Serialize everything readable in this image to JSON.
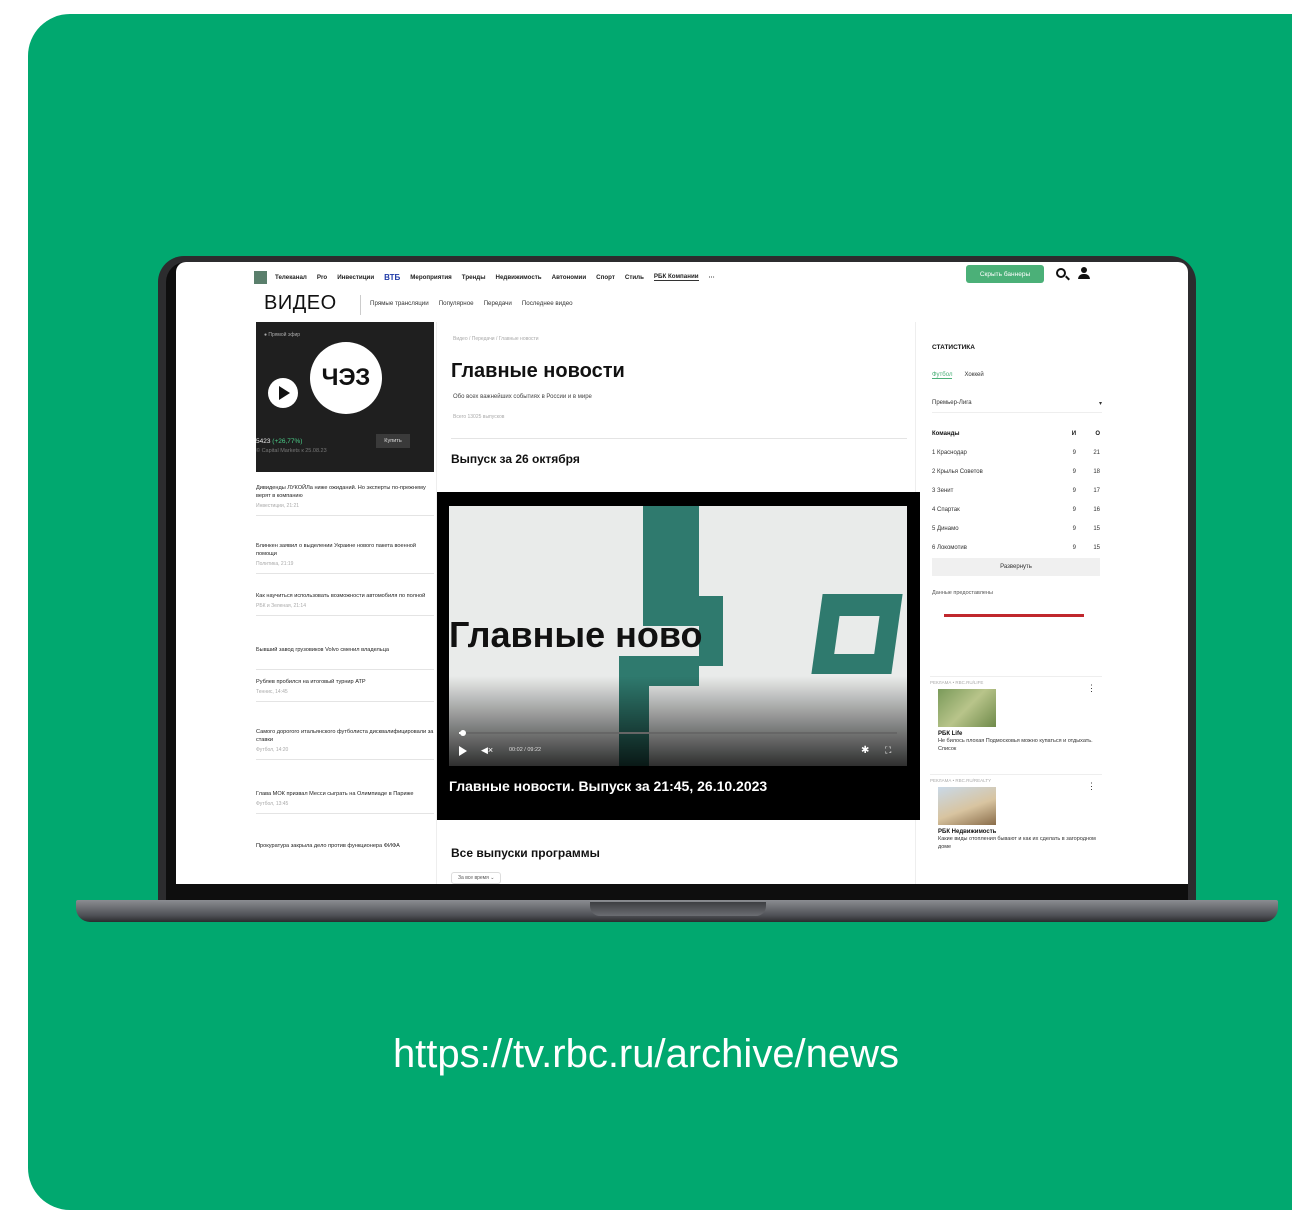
{
  "colors": {
    "background": "#01a86f",
    "accent": "#4bb078",
    "video_bg": "#000000",
    "brand_teal": "#2f7a6e"
  },
  "url": "https://tv.rbc.ru/archive/news",
  "topnav": {
    "items": [
      "Телеканал",
      "Pro",
      "Инвестиции"
    ],
    "vtb": "ВТБ",
    "items2": [
      "Мероприятия",
      "Тренды",
      "Недвижимость",
      "Автономии",
      "Спорт",
      "Стиль"
    ],
    "companies": "РБК Компании",
    "more": "···",
    "banner_button": "Скрыть баннеры"
  },
  "section": {
    "title": "ВИДЕО",
    "subnav": [
      "Прямые трансляции",
      "Популярное",
      "Передачи",
      "Последнее видео"
    ]
  },
  "left": {
    "live_label": "● Прямой эфир",
    "logo_text": "ЧЭЗ",
    "quote_value": "5423",
    "quote_change": "(+26,77%)",
    "quote_source": "© Capital Markets к 25.08.23",
    "buy_button": "Купить",
    "news": [
      {
        "title": "Дивиденды ЛУКОЙЛа ниже ожиданий. Но эксперты по-прежнему верят в компанию",
        "meta": "Инвестиции, 21:21"
      },
      {
        "title": "Блинкен заявил о выделении Украине нового пакета военной помощи",
        "meta": "Политика, 21:19"
      },
      {
        "title": "Как научиться использовать возможности автомобиля по полной",
        "meta": "РБК и Зеленая, 21:14"
      },
      {
        "title": "Бывший завод грузовиков Volvo сменил владельца",
        "meta": ""
      },
      {
        "title": "Рублев пробился на итоговый турнир ATP",
        "meta": "Теннис, 14:45"
      },
      {
        "title": "Самого дорогого итальянского футболиста дисквалифицировали за ставки",
        "meta": "Футбол, 14:20"
      },
      {
        "title": "Глава МОК призвал Месси сыграть на Олимпиаде в Париже",
        "meta": "Футбол, 13:45"
      },
      {
        "title": "Прокуратура закрыла дело против функционера ФИФА",
        "meta": ""
      }
    ]
  },
  "main": {
    "breadcrumb": "Видео / Передачи / Главные новости",
    "title": "Главные новости",
    "description": "Обо всех важнейших событиях в России и в мире",
    "issues_count": "Всего 13025 выпусков",
    "issue_title": "Выпуск за 26 октября",
    "video_text": "Главные ново",
    "video_time": "00:02 / 09:22",
    "video_progress": 0.01,
    "video_caption": "Главные новости. Выпуск за 21:45, 26.10.2023",
    "all_issues": "Все выпуски программы",
    "filter": "За все время ⌄"
  },
  "right": {
    "stat_title": "СТАТИСТИКА",
    "tabs": [
      "Футбол",
      "Хоккей"
    ],
    "league": "Премьер-Лига",
    "table_headers": [
      "Команды",
      "И",
      "О"
    ],
    "rows": [
      [
        "1  Краснодар",
        "9",
        "21"
      ],
      [
        "2  Крылья Советов",
        "9",
        "18"
      ],
      [
        "3  Зенит",
        "9",
        "17"
      ],
      [
        "4  Спартак",
        "9",
        "16"
      ],
      [
        "5  Динамо",
        "9",
        "15"
      ],
      [
        "6  Локомотив",
        "9",
        "15"
      ]
    ],
    "expand_button": "Развернуть",
    "data_note": "Данные предоставлены",
    "promos": [
      {
        "source": "РЕКЛАМА • RBC.RU/LIFE",
        "title": "РБК Life",
        "text": "Не билось плохая Подмосковья можно купаться и отдыхать. Список"
      },
      {
        "source": "РЕКЛАМА • RBC.RU/REALTY",
        "title": "РБК Недвижимость",
        "text": "Какие виды отопления бывают и как их сделать в загородном доме"
      }
    ]
  }
}
